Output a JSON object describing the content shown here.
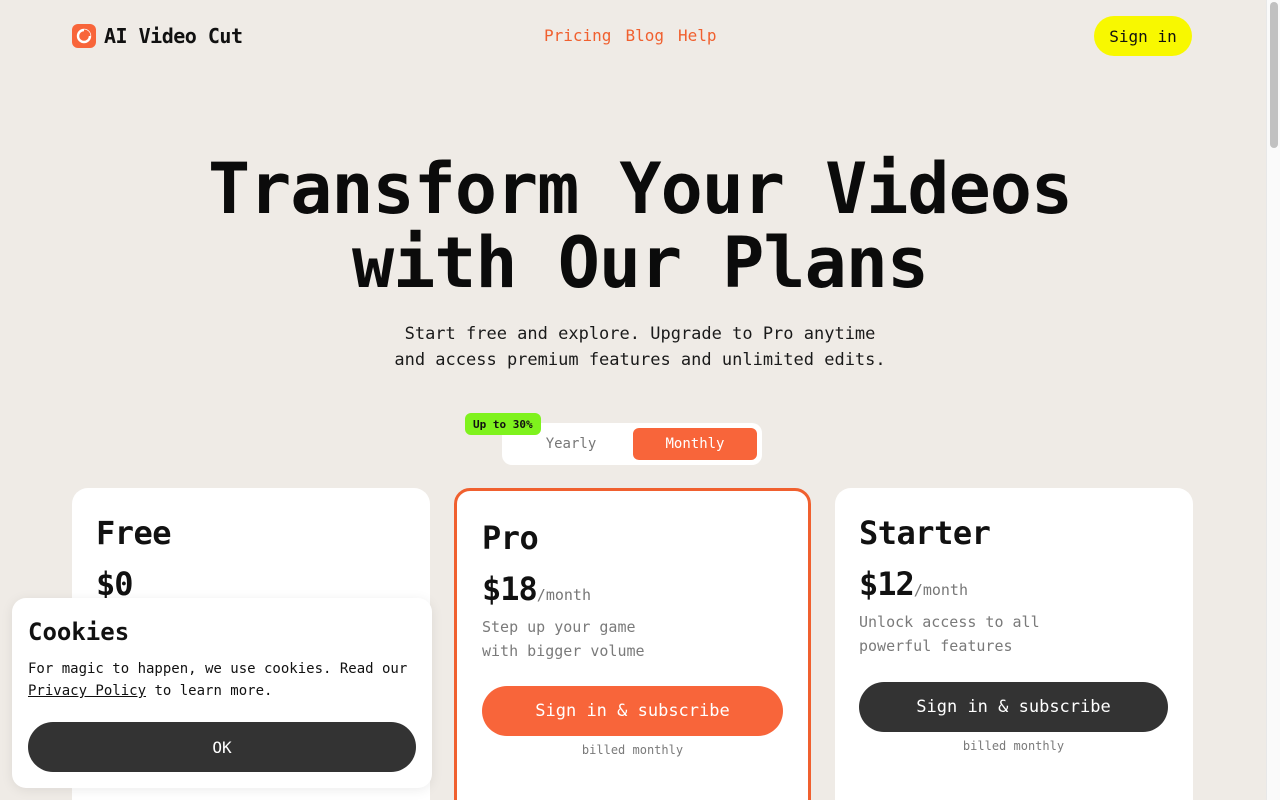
{
  "header": {
    "brand": "AI Video Cut",
    "nav": [
      "Pricing",
      "Blog",
      "Help"
    ],
    "signin_label": "Sign in"
  },
  "hero": {
    "title_line1": "Transform Your Videos",
    "title_line2": "with Our Plans",
    "subtitle_line1": "Start free and explore. Upgrade to Pro anytime",
    "subtitle_line2": "and access premium features and unlimited edits."
  },
  "billing_toggle": {
    "badge": "Up to 30%",
    "yearly": "Yearly",
    "monthly": "Monthly",
    "selected": "Monthly"
  },
  "plans": {
    "free": {
      "name": "Free",
      "price": "$0"
    },
    "pro": {
      "name": "Pro",
      "price": "$18",
      "per": "/month",
      "desc_line1": "Step up your game",
      "desc_line2": "with bigger volume",
      "button": "Sign in & subscribe",
      "billed": "billed monthly"
    },
    "starter": {
      "name": "Starter",
      "price": "$12",
      "per": "/month",
      "desc_line1": "Unlock access to all",
      "desc_line2": "powerful features",
      "button": "Sign in & subscribe",
      "billed": "billed monthly"
    }
  },
  "cookie": {
    "title": "Cookies",
    "text_before": "For magic to happen, we use cookies. Read our",
    "link": "Privacy Policy",
    "text_after": "to learn more.",
    "ok": "OK"
  },
  "colors": {
    "accent": "#f8653a",
    "signin_bg": "#f8f800",
    "badge_bg": "#7ff21d",
    "background": "#efebe6",
    "dark_button": "#333333"
  }
}
